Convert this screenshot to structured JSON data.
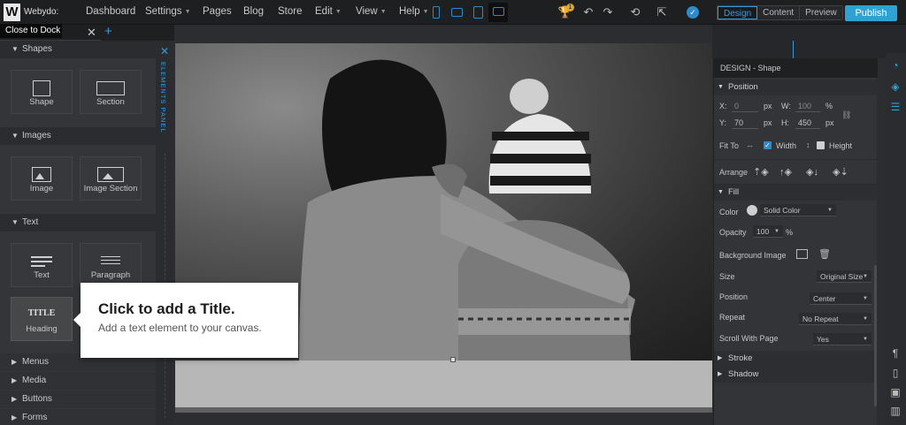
{
  "brand": {
    "logo_letter": "W",
    "name": "Webydo:"
  },
  "nav": [
    {
      "label": "Dashboard",
      "caret": false
    },
    {
      "label": "Settings",
      "caret": true
    },
    {
      "label": "Pages",
      "caret": false
    },
    {
      "label": "Blog",
      "caret": false
    },
    {
      "label": "Store",
      "caret": false
    },
    {
      "label": "Edit",
      "caret": true
    },
    {
      "label": "View",
      "caret": true
    },
    {
      "label": "Help",
      "caret": true
    }
  ],
  "trophy_badge": "1",
  "modes": {
    "design": "Design",
    "content": "Content",
    "preview": "Preview"
  },
  "publish_label": "Publish",
  "dock_tip": "Close to Dock",
  "elements_panel_label": "ELEMENTS PANEL",
  "categories": {
    "shapes": "Shapes",
    "images": "Images",
    "text": "Text",
    "menus": "Menus",
    "media": "Media",
    "buttons": "Buttons",
    "forms": "Forms"
  },
  "tiles": {
    "shape": "Shape",
    "section": "Section",
    "image": "Image",
    "image_section": "Image Section",
    "text": "Text",
    "paragraph": "Paragraph",
    "heading": "Heading",
    "heading_glyph": "TITLE"
  },
  "tooltip": {
    "title": "Click to add a Title.",
    "subtitle": "Add a text element to your canvas."
  },
  "design_panel": {
    "title": "DESIGN - Shape",
    "position_section": "Position",
    "x_label": "X:",
    "x_value": "0",
    "x_unit": "px",
    "w_label": "W:",
    "w_value": "100",
    "w_unit": "%",
    "y_label": "Y:",
    "y_value": "70",
    "y_unit": "px",
    "h_label": "H:",
    "h_value": "450",
    "h_unit": "px",
    "fit_to": "Fit To",
    "width_label": "Width",
    "height_label": "Height",
    "arrange": "Arrange",
    "fill_section": "Fill",
    "color_label": "Color",
    "color_value": "Solid Color",
    "opacity_label": "Opacity",
    "opacity_value": "100",
    "opacity_unit": "%",
    "bg_image_label": "Background Image",
    "size_label": "Size",
    "size_value": "Original Size",
    "position_label": "Position",
    "position_value": "Center",
    "repeat_label": "Repeat",
    "repeat_value": "No Repeat",
    "scroll_label": "Scroll With Page",
    "scroll_value": "Yes",
    "stroke_section": "Stroke",
    "shadow_section": "Shadow"
  },
  "colors": {
    "accent": "#2fa2d4",
    "topbar": "#1e1f21",
    "panel": "#333538"
  }
}
